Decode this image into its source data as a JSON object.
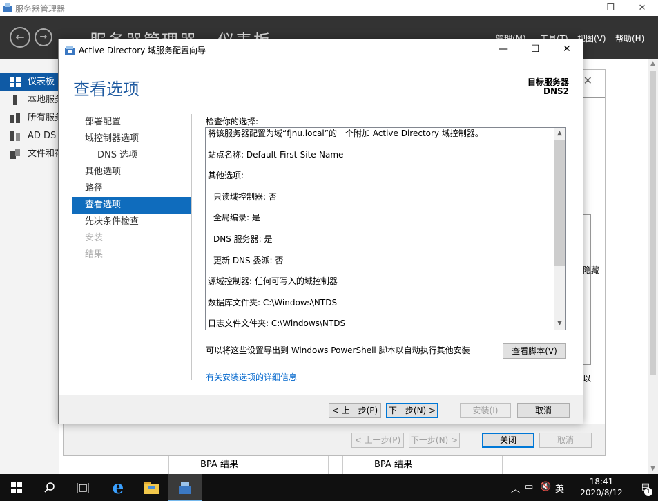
{
  "server_manager": {
    "title": "服务器管理器",
    "breadcrumb": "服务器管理器 · 仪表板",
    "menu": [
      "管理(M)",
      "工具(T)",
      "视图(V)",
      "帮助(H)"
    ],
    "sidebar": [
      {
        "label": "仪表板"
      },
      {
        "label": "本地服务器"
      },
      {
        "label": "所有服务器"
      },
      {
        "label": "AD DS"
      },
      {
        "label": "文件和存储服务"
      }
    ],
    "bg_partial": {
      "hide": "隐藏",
      "suffix": "以"
    },
    "bg_buttons": {
      "prev": "< 上一步(P)",
      "next": "下一步(N) >",
      "close": "关闭",
      "cancel": "取消"
    },
    "bpa": [
      "BPA 结果",
      "BPA 结果"
    ]
  },
  "wizard": {
    "title": "Active Directory 域服务配置向导",
    "heading": "查看选项",
    "target_label": "目标服务器",
    "target_value": "DNS2",
    "nav": [
      {
        "label": "部署配置",
        "state": "normal"
      },
      {
        "label": "域控制器选项",
        "state": "normal"
      },
      {
        "label": "DNS 选项",
        "state": "sub"
      },
      {
        "label": "其他选项",
        "state": "normal"
      },
      {
        "label": "路径",
        "state": "normal"
      },
      {
        "label": "查看选项",
        "state": "current"
      },
      {
        "label": "先决条件检查",
        "state": "normal"
      },
      {
        "label": "安装",
        "state": "disabled"
      },
      {
        "label": "结果",
        "state": "disabled"
      }
    ],
    "review_label": "检查你的选择:",
    "review_lines": [
      "将该服务器配置为域“fjnu.local”的一个附加 Active Directory 域控制器。",
      "站点名称: Default-First-Site-Name",
      "其他选项:",
      "只读域控制器: 否",
      "全局编录: 是",
      "DNS 服务器: 是",
      "更新 DNS 委派: 否",
      "源域控制器: 任何可写入的域控制器",
      "数据库文件夹: C:\\Windows\\NTDS",
      "日志文件文件夹: C:\\Windows\\NTDS"
    ],
    "export_text": "可以将这些设置导出到 Windows PowerShell 脚本以自动执行其他安装",
    "view_script_button": "查看脚本(V)",
    "more_link": "有关安装选项的详细信息",
    "buttons": {
      "prev": "< 上一步(P)",
      "next": "下一步(N) >",
      "install": "安装(I)",
      "cancel": "取消"
    }
  },
  "taskbar": {
    "clock_time": "18:41",
    "clock_date": "2020/8/12",
    "ime": "英",
    "notification_count": "1"
  }
}
